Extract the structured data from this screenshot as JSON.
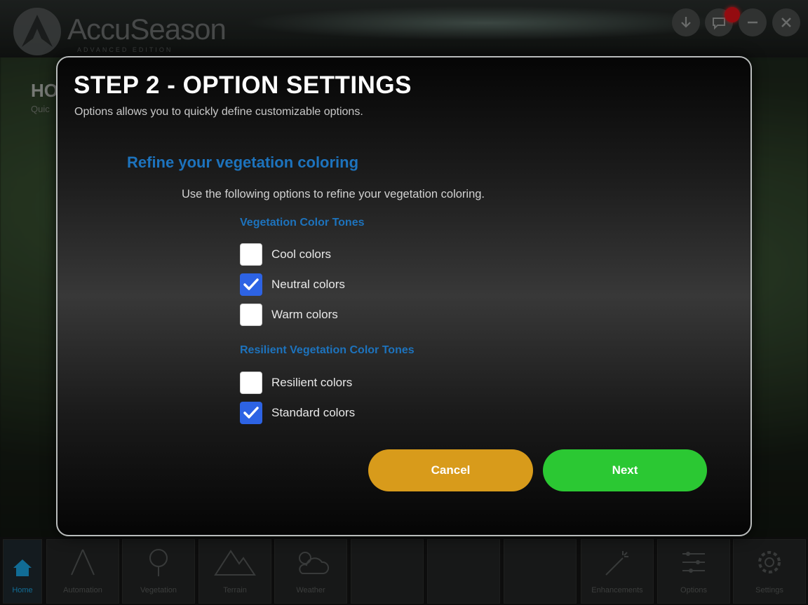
{
  "app": {
    "logo_text": "AccuSeason",
    "logo_subtitle": "ADVANCED EDITION",
    "home_title": "HO",
    "home_subtitle": "Quic"
  },
  "window_controls": {
    "download_icon": "download-icon",
    "chat_icon": "chat-icon",
    "minimize_icon": "minimize-icon",
    "close_icon": "close-icon"
  },
  "dock": {
    "items": [
      {
        "label": "Home",
        "icon": "home-icon"
      },
      {
        "label": "Automation",
        "icon": "automation-icon"
      },
      {
        "label": "Vegetation",
        "icon": "tree-icon"
      },
      {
        "label": "Terrain",
        "icon": "mountain-icon"
      },
      {
        "label": "Weather",
        "icon": "weather-icon"
      },
      {
        "label": "",
        "icon": ""
      },
      {
        "label": "",
        "icon": ""
      },
      {
        "label": "",
        "icon": ""
      },
      {
        "label": "Enhancements",
        "icon": "magic-wand-icon"
      },
      {
        "label": "Options",
        "icon": "sliders-icon"
      },
      {
        "label": "Settings",
        "icon": "gear-icon"
      }
    ]
  },
  "modal": {
    "title": "STEP 2 - OPTION SETTINGS",
    "subtitle": "Options allows you to quickly define customizable options.",
    "section_heading": "Refine your vegetation coloring",
    "section_desc": "Use the following options to refine your vegetation coloring.",
    "groups": [
      {
        "label": "Vegetation Color Tones",
        "options": [
          {
            "label": "Cool colors",
            "checked": false
          },
          {
            "label": "Neutral colors",
            "checked": true
          },
          {
            "label": "Warm colors",
            "checked": false
          }
        ]
      },
      {
        "label": "Resilient Vegetation Color Tones",
        "options": [
          {
            "label": "Resilient colors",
            "checked": false
          },
          {
            "label": "Standard colors",
            "checked": true
          }
        ]
      }
    ],
    "cancel_label": "Cancel",
    "next_label": "Next"
  },
  "colors": {
    "accent_blue": "#1d73bd",
    "checkbox_checked": "#2d63e4",
    "cancel": "#d89b1b",
    "next": "#2bc833",
    "notification": "#e3121a"
  }
}
